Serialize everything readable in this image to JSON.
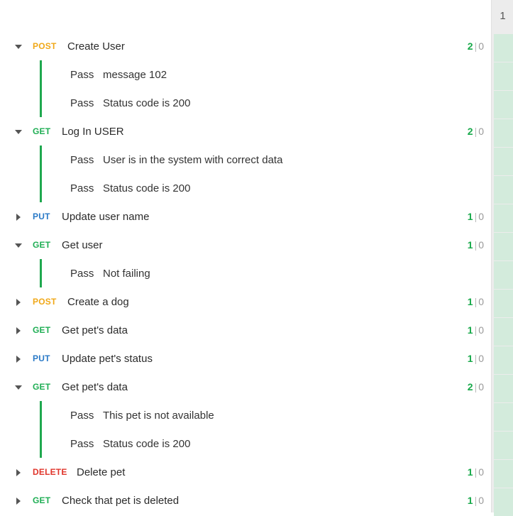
{
  "colors": {
    "POST": "#f0a818",
    "GET": "#1fae54",
    "PUT": "#2a7ac7",
    "DELETE": "#e0352b"
  },
  "rail": {
    "number": "1"
  },
  "requests": [
    {
      "method": "POST",
      "name": "Create User",
      "expanded": true,
      "pass": "2",
      "fail": "0",
      "tests": [
        {
          "status": "Pass",
          "name": "message 102"
        },
        {
          "status": "Pass",
          "name": "Status code is 200"
        }
      ]
    },
    {
      "method": "GET",
      "name": "Log In USER",
      "expanded": true,
      "pass": "2",
      "fail": "0",
      "tests": [
        {
          "status": "Pass",
          "name": "User is in the system with correct data"
        },
        {
          "status": "Pass",
          "name": "Status code is 200"
        }
      ]
    },
    {
      "method": "PUT",
      "name": "Update user name",
      "expanded": false,
      "pass": "1",
      "fail": "0",
      "tests": []
    },
    {
      "method": "GET",
      "name": "Get user",
      "expanded": true,
      "pass": "1",
      "fail": "0",
      "tests": [
        {
          "status": "Pass",
          "name": "Not failing"
        }
      ]
    },
    {
      "method": "POST",
      "name": "Create a dog",
      "expanded": false,
      "pass": "1",
      "fail": "0",
      "tests": []
    },
    {
      "method": "GET",
      "name": "Get pet's data",
      "expanded": false,
      "pass": "1",
      "fail": "0",
      "tests": []
    },
    {
      "method": "PUT",
      "name": "Update pet's status",
      "expanded": false,
      "pass": "1",
      "fail": "0",
      "tests": []
    },
    {
      "method": "GET",
      "name": "Get pet's data",
      "expanded": true,
      "pass": "2",
      "fail": "0",
      "tests": [
        {
          "status": "Pass",
          "name": "This pet is not available"
        },
        {
          "status": "Pass",
          "name": "Status code is 200"
        }
      ]
    },
    {
      "method": "DELETE",
      "name": "Delete pet",
      "expanded": false,
      "pass": "1",
      "fail": "0",
      "tests": []
    },
    {
      "method": "GET",
      "name": "Check that pet is deleted",
      "expanded": false,
      "pass": "1",
      "fail": "0",
      "tests": []
    }
  ]
}
